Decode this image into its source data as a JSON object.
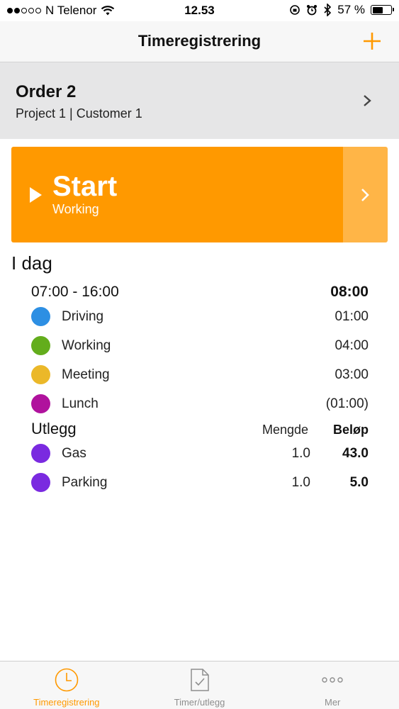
{
  "status_bar": {
    "carrier": "N Telenor",
    "time": "12.53",
    "battery": "57 %",
    "battery_level": 0.57
  },
  "nav": {
    "title": "Timeregistrering"
  },
  "order": {
    "title": "Order 2",
    "subtitle": "Project 1 | Customer 1"
  },
  "start": {
    "label": "Start",
    "activity": "Working"
  },
  "today": {
    "title": "I dag",
    "range": "07:00 - 16:00",
    "total": "08:00",
    "activities": [
      {
        "name": "Driving",
        "time": "01:00",
        "color": "#2d8fe3"
      },
      {
        "name": "Working",
        "time": "04:00",
        "color": "#63ad1c"
      },
      {
        "name": "Meeting",
        "time": "03:00",
        "color": "#ebb829"
      },
      {
        "name": "Lunch",
        "time": "(01:00)",
        "color": "#b0129d"
      }
    ]
  },
  "expenses": {
    "title": "Utlegg",
    "qty_header": "Mengde",
    "amount_header": "Beløp",
    "items": [
      {
        "name": "Gas",
        "qty": "1.0",
        "amount": "43.0",
        "color": "#7a2ae0"
      },
      {
        "name": "Parking",
        "qty": "1.0",
        "amount": "5.0",
        "color": "#7a2ae0"
      }
    ]
  },
  "tabs": [
    {
      "label": "Timeregistrering",
      "icon": "clock-icon",
      "active": true
    },
    {
      "label": "Timer/utlegg",
      "icon": "document-check-icon",
      "active": false
    },
    {
      "label": "Mer",
      "icon": "more-dots-icon",
      "active": false
    }
  ],
  "colors": {
    "accent": "#ff9900",
    "accent_light": "#ffb547",
    "header_gray": "#e6e6e7"
  }
}
